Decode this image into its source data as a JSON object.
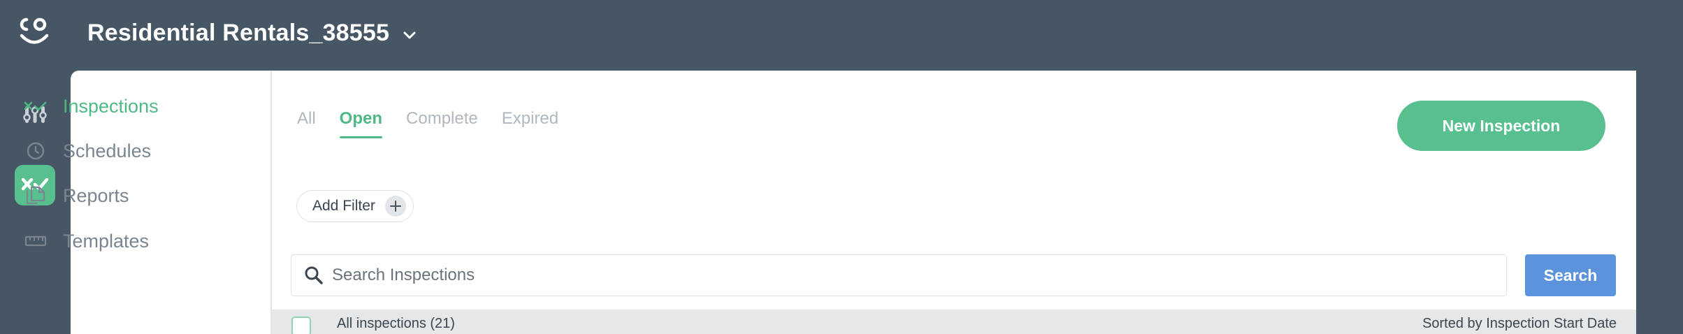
{
  "app": {
    "workspace_title": "Residential Rentals_38555"
  },
  "rail": {
    "logo": "co-smiley-logo",
    "items": [
      {
        "icon": "sliders-icon",
        "active": false
      },
      {
        "icon": "inspections-check-icon",
        "active": true
      }
    ]
  },
  "sidenav": {
    "items": [
      {
        "label": "Inspections",
        "icon": "inspections-icon",
        "active": true
      },
      {
        "label": "Schedules",
        "icon": "clock-icon",
        "active": false
      },
      {
        "label": "Reports",
        "icon": "reports-icon",
        "active": false
      },
      {
        "label": "Templates",
        "icon": "ruler-icon",
        "active": false
      }
    ]
  },
  "tabs": [
    {
      "label": "All",
      "active": false
    },
    {
      "label": "Open",
      "active": true
    },
    {
      "label": "Complete",
      "active": false
    },
    {
      "label": "Expired",
      "active": false
    }
  ],
  "toolbar": {
    "new_inspection_label": "New Inspection",
    "add_filter_label": "Add Filter"
  },
  "search": {
    "placeholder": "Search Inspections",
    "value": "",
    "button_label": "Search"
  },
  "list": {
    "all_label": "All inspections (21)",
    "sort_label": "Sorted by Inspection Start Date"
  },
  "colors": {
    "header_bg": "#475664",
    "accent_green": "#57c08e",
    "search_blue": "#5b93dd"
  }
}
